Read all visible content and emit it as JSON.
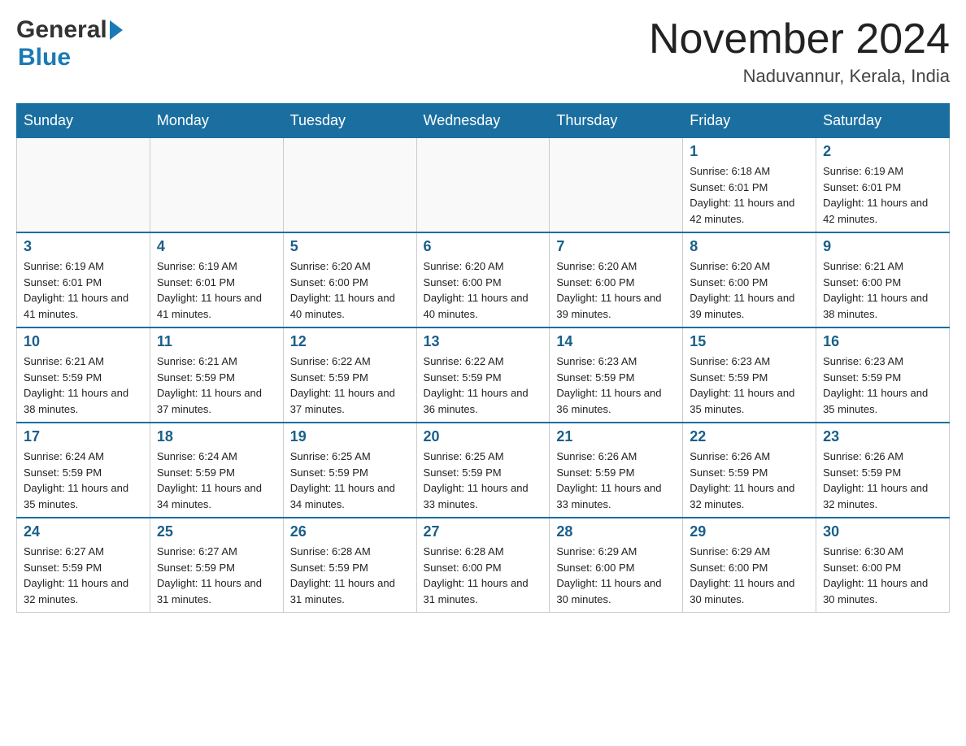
{
  "logo": {
    "line1": "General",
    "line2": "Blue"
  },
  "header": {
    "month": "November 2024",
    "location": "Naduvannur, Kerala, India"
  },
  "weekdays": [
    "Sunday",
    "Monday",
    "Tuesday",
    "Wednesday",
    "Thursday",
    "Friday",
    "Saturday"
  ],
  "weeks": [
    [
      {
        "day": "",
        "info": ""
      },
      {
        "day": "",
        "info": ""
      },
      {
        "day": "",
        "info": ""
      },
      {
        "day": "",
        "info": ""
      },
      {
        "day": "",
        "info": ""
      },
      {
        "day": "1",
        "info": "Sunrise: 6:18 AM\nSunset: 6:01 PM\nDaylight: 11 hours and 42 minutes."
      },
      {
        "day": "2",
        "info": "Sunrise: 6:19 AM\nSunset: 6:01 PM\nDaylight: 11 hours and 42 minutes."
      }
    ],
    [
      {
        "day": "3",
        "info": "Sunrise: 6:19 AM\nSunset: 6:01 PM\nDaylight: 11 hours and 41 minutes."
      },
      {
        "day": "4",
        "info": "Sunrise: 6:19 AM\nSunset: 6:01 PM\nDaylight: 11 hours and 41 minutes."
      },
      {
        "day": "5",
        "info": "Sunrise: 6:20 AM\nSunset: 6:00 PM\nDaylight: 11 hours and 40 minutes."
      },
      {
        "day": "6",
        "info": "Sunrise: 6:20 AM\nSunset: 6:00 PM\nDaylight: 11 hours and 40 minutes."
      },
      {
        "day": "7",
        "info": "Sunrise: 6:20 AM\nSunset: 6:00 PM\nDaylight: 11 hours and 39 minutes."
      },
      {
        "day": "8",
        "info": "Sunrise: 6:20 AM\nSunset: 6:00 PM\nDaylight: 11 hours and 39 minutes."
      },
      {
        "day": "9",
        "info": "Sunrise: 6:21 AM\nSunset: 6:00 PM\nDaylight: 11 hours and 38 minutes."
      }
    ],
    [
      {
        "day": "10",
        "info": "Sunrise: 6:21 AM\nSunset: 5:59 PM\nDaylight: 11 hours and 38 minutes."
      },
      {
        "day": "11",
        "info": "Sunrise: 6:21 AM\nSunset: 5:59 PM\nDaylight: 11 hours and 37 minutes."
      },
      {
        "day": "12",
        "info": "Sunrise: 6:22 AM\nSunset: 5:59 PM\nDaylight: 11 hours and 37 minutes."
      },
      {
        "day": "13",
        "info": "Sunrise: 6:22 AM\nSunset: 5:59 PM\nDaylight: 11 hours and 36 minutes."
      },
      {
        "day": "14",
        "info": "Sunrise: 6:23 AM\nSunset: 5:59 PM\nDaylight: 11 hours and 36 minutes."
      },
      {
        "day": "15",
        "info": "Sunrise: 6:23 AM\nSunset: 5:59 PM\nDaylight: 11 hours and 35 minutes."
      },
      {
        "day": "16",
        "info": "Sunrise: 6:23 AM\nSunset: 5:59 PM\nDaylight: 11 hours and 35 minutes."
      }
    ],
    [
      {
        "day": "17",
        "info": "Sunrise: 6:24 AM\nSunset: 5:59 PM\nDaylight: 11 hours and 35 minutes."
      },
      {
        "day": "18",
        "info": "Sunrise: 6:24 AM\nSunset: 5:59 PM\nDaylight: 11 hours and 34 minutes."
      },
      {
        "day": "19",
        "info": "Sunrise: 6:25 AM\nSunset: 5:59 PM\nDaylight: 11 hours and 34 minutes."
      },
      {
        "day": "20",
        "info": "Sunrise: 6:25 AM\nSunset: 5:59 PM\nDaylight: 11 hours and 33 minutes."
      },
      {
        "day": "21",
        "info": "Sunrise: 6:26 AM\nSunset: 5:59 PM\nDaylight: 11 hours and 33 minutes."
      },
      {
        "day": "22",
        "info": "Sunrise: 6:26 AM\nSunset: 5:59 PM\nDaylight: 11 hours and 32 minutes."
      },
      {
        "day": "23",
        "info": "Sunrise: 6:26 AM\nSunset: 5:59 PM\nDaylight: 11 hours and 32 minutes."
      }
    ],
    [
      {
        "day": "24",
        "info": "Sunrise: 6:27 AM\nSunset: 5:59 PM\nDaylight: 11 hours and 32 minutes."
      },
      {
        "day": "25",
        "info": "Sunrise: 6:27 AM\nSunset: 5:59 PM\nDaylight: 11 hours and 31 minutes."
      },
      {
        "day": "26",
        "info": "Sunrise: 6:28 AM\nSunset: 5:59 PM\nDaylight: 11 hours and 31 minutes."
      },
      {
        "day": "27",
        "info": "Sunrise: 6:28 AM\nSunset: 6:00 PM\nDaylight: 11 hours and 31 minutes."
      },
      {
        "day": "28",
        "info": "Sunrise: 6:29 AM\nSunset: 6:00 PM\nDaylight: 11 hours and 30 minutes."
      },
      {
        "day": "29",
        "info": "Sunrise: 6:29 AM\nSunset: 6:00 PM\nDaylight: 11 hours and 30 minutes."
      },
      {
        "day": "30",
        "info": "Sunrise: 6:30 AM\nSunset: 6:00 PM\nDaylight: 11 hours and 30 minutes."
      }
    ]
  ]
}
